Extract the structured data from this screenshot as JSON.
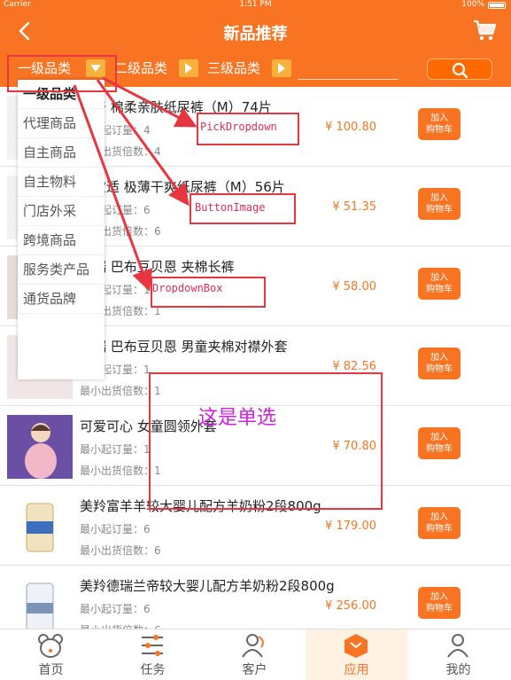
{
  "status": {
    "carrier": "Carrier",
    "time": "1:51 PM",
    "battery": "100%"
  },
  "nav": {
    "title": "新品推荐"
  },
  "filters": {
    "level1": "一级品类",
    "level2": "二级品类",
    "level3": "三级品类"
  },
  "dropdown": {
    "items": [
      "一级品类",
      "代理商品",
      "自主商品",
      "自主物料",
      "门店外采",
      "跨境商品",
      "服务类产品",
      "通货品牌"
    ]
  },
  "labels": {
    "min_order": "最小起订量：",
    "min_multiple": "最小出货倍数：",
    "add_cart_line1": "加入",
    "add_cart_line2": "购物车"
  },
  "products": [
    {
      "name": "好奇 棉柔亲肤纸尿裤（M）74片",
      "min_order": "4",
      "min_multiple": "4",
      "price": "¥ 100.80"
    },
    {
      "name": "帮宝适 极薄干爽纸尿裤（M）56片",
      "min_order": "6",
      "min_multiple": "6",
      "price": "¥ 51.35"
    },
    {
      "name": "贝瑞 巴布豆贝恩 夹棉长裤",
      "min_order": "1",
      "min_multiple": "1",
      "price": "¥ 58.00"
    },
    {
      "name": "贝瑞 巴布豆贝恩 男童夹棉对襟外套",
      "min_order": "1",
      "min_multiple": "1",
      "price": "¥ 82.56"
    },
    {
      "name": "可爱可心 女童圆领外套",
      "min_order": "1",
      "min_multiple": "1",
      "price": "¥ 70.80"
    },
    {
      "name": "美羚富羊羊较大婴儿配方羊奶粉2段800g",
      "min_order": "6",
      "min_multiple": "6",
      "price": "¥ 179.00"
    },
    {
      "name": "美羚德瑞兰帝较大婴儿配方羊奶粉2段800g",
      "min_order": "6",
      "min_multiple": "6",
      "price": "¥ 256.00"
    }
  ],
  "annotations": {
    "pick": "PickDropdown",
    "button": "ButtonImage",
    "box": "DropdownBox",
    "note": "这是单选"
  },
  "tabs": [
    {
      "label": "首页",
      "icon": "home-bear-icon"
    },
    {
      "label": "任务",
      "icon": "sliders-icon"
    },
    {
      "label": "客户",
      "icon": "customers-icon"
    },
    {
      "label": "应用",
      "icon": "apps-cube-icon"
    },
    {
      "label": "我的",
      "icon": "profile-icon"
    }
  ],
  "colors": {
    "brand": "#f87423",
    "annotation_red": "#e9353f",
    "annotation_text": "#e02c57",
    "annotation_magenta": "#d020e0"
  }
}
